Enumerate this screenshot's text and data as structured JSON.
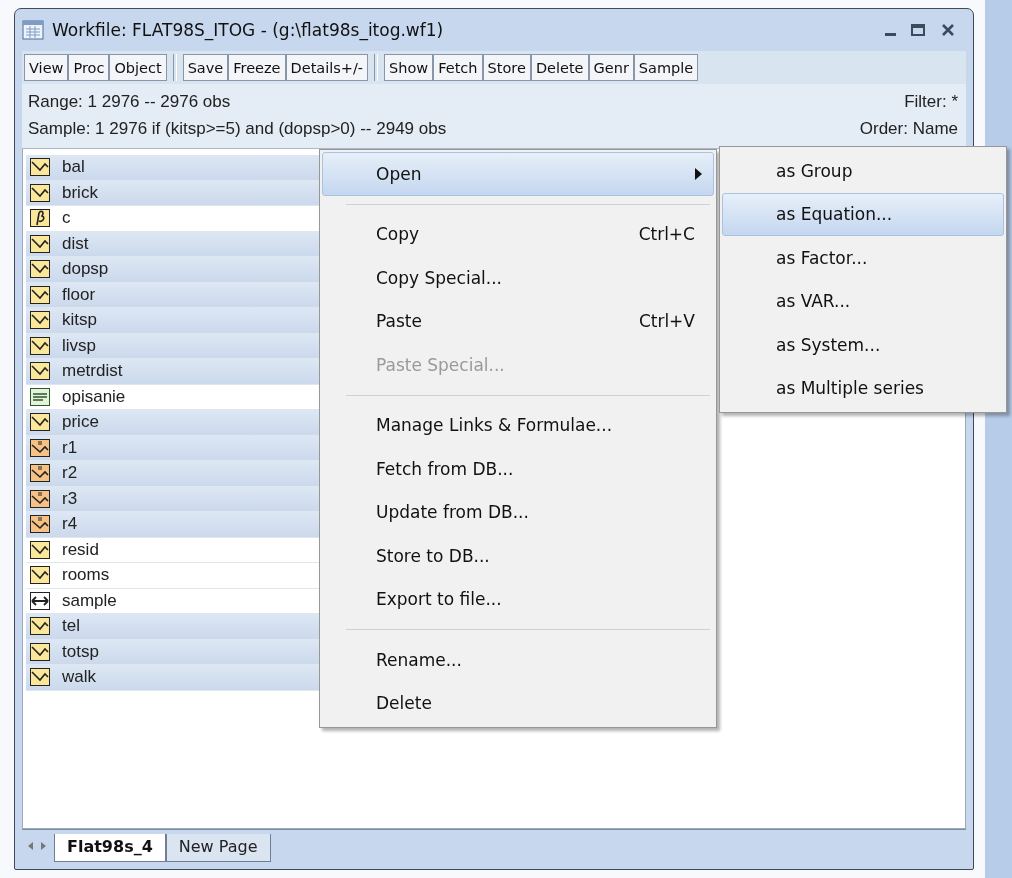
{
  "window": {
    "title": "Workfile: FLAT98S_ITOG - (g:\\flat98s_itog.wf1)"
  },
  "toolbar": [
    [
      "View",
      "Proc",
      "Object"
    ],
    [
      "Save",
      "Freeze",
      "Details+/-"
    ],
    [
      "Show",
      "Fetch",
      "Store",
      "Delete",
      "Genr",
      "Sample"
    ]
  ],
  "info": {
    "range": "Range:  1 2976  --  2976 obs",
    "filter": "Filter: *",
    "sample": "Sample: 1 2976 if (kitsp>=5) and (dopsp>0)  --  2949 obs",
    "order": "Order: Name"
  },
  "objects": [
    {
      "name": "bal",
      "kind": "series",
      "selected": true
    },
    {
      "name": "brick",
      "kind": "series",
      "selected": true
    },
    {
      "name": "c",
      "kind": "coef",
      "selected": false
    },
    {
      "name": "dist",
      "kind": "series",
      "selected": true
    },
    {
      "name": "dopsp",
      "kind": "series",
      "selected": true
    },
    {
      "name": "floor",
      "kind": "series",
      "selected": true
    },
    {
      "name": "kitsp",
      "kind": "series",
      "selected": true
    },
    {
      "name": "livsp",
      "kind": "series",
      "selected": true
    },
    {
      "name": "metrdist",
      "kind": "series",
      "selected": true
    },
    {
      "name": "opisanie",
      "kind": "text",
      "selected": false
    },
    {
      "name": "price",
      "kind": "series",
      "selected": true
    },
    {
      "name": "r1",
      "kind": "formula",
      "selected": true
    },
    {
      "name": "r2",
      "kind": "formula",
      "selected": true
    },
    {
      "name": "r3",
      "kind": "formula",
      "selected": true
    },
    {
      "name": "r4",
      "kind": "formula",
      "selected": true
    },
    {
      "name": "resid",
      "kind": "series",
      "selected": false
    },
    {
      "name": "rooms",
      "kind": "series",
      "selected": false
    },
    {
      "name": "sample",
      "kind": "sample",
      "selected": false
    },
    {
      "name": "tel",
      "kind": "series",
      "selected": true
    },
    {
      "name": "totsp",
      "kind": "series",
      "selected": true
    },
    {
      "name": "walk",
      "kind": "series",
      "selected": true
    }
  ],
  "context_menu": [
    {
      "kind": "item",
      "label": "Open",
      "submenu": true,
      "selected": true,
      "disabled": false
    },
    {
      "kind": "separator"
    },
    {
      "kind": "item",
      "label": "Copy",
      "shortcut": "Ctrl+C",
      "selected": false,
      "disabled": false
    },
    {
      "kind": "item",
      "label": "Copy Special...",
      "selected": false,
      "disabled": false
    },
    {
      "kind": "item",
      "label": "Paste",
      "shortcut": "Ctrl+V",
      "selected": false,
      "disabled": false
    },
    {
      "kind": "item",
      "label": "Paste Special...",
      "selected": false,
      "disabled": true
    },
    {
      "kind": "separator"
    },
    {
      "kind": "item",
      "label": "Manage Links & Formulae...",
      "selected": false,
      "disabled": false
    },
    {
      "kind": "item",
      "label": "Fetch from DB...",
      "selected": false,
      "disabled": false
    },
    {
      "kind": "item",
      "label": "Update from DB...",
      "selected": false,
      "disabled": false
    },
    {
      "kind": "item",
      "label": "Store to DB...",
      "selected": false,
      "disabled": false
    },
    {
      "kind": "item",
      "label": "Export to file...",
      "selected": false,
      "disabled": false
    },
    {
      "kind": "separator"
    },
    {
      "kind": "item",
      "label": "Rename...",
      "selected": false,
      "disabled": false
    },
    {
      "kind": "item",
      "label": "Delete",
      "selected": false,
      "disabled": false
    }
  ],
  "submenu": [
    {
      "label": "as Group",
      "selected": false
    },
    {
      "label": "as Equation...",
      "selected": true
    },
    {
      "label": "as Factor...",
      "selected": false
    },
    {
      "label": "as VAR...",
      "selected": false
    },
    {
      "label": "as System...",
      "selected": false
    },
    {
      "label": "as Multiple series",
      "selected": false
    }
  ],
  "page_tabs": [
    {
      "label": "Flat98s_4",
      "selected": true
    },
    {
      "label": "New Page",
      "selected": false
    }
  ]
}
